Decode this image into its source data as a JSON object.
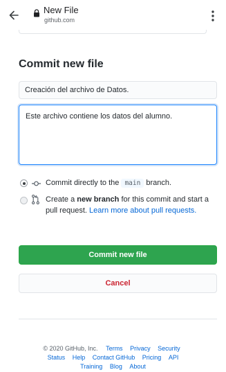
{
  "browser": {
    "page_title": "New File",
    "url": "github.com"
  },
  "form": {
    "heading": "Commit new file",
    "summary_value": "Creación del archivo de Datos.",
    "description_value": "Este archivo contiene los datos del alumno.",
    "option_direct": {
      "prefix": "Commit directly to the",
      "branch": "main",
      "suffix": "branch."
    },
    "option_new_branch": {
      "prefix": "Create a",
      "bold": "new branch",
      "middle": "for this commit and start a pull request.",
      "link": "Learn more about pull requests."
    },
    "commit_label": "Commit new file",
    "cancel_label": "Cancel"
  },
  "footer": {
    "copyright": "© 2020 GitHub, Inc.",
    "row1_links": [
      "Terms",
      "Privacy",
      "Security"
    ],
    "row2_links": [
      "Status",
      "Help",
      "Contact GitHub",
      "Pricing",
      "API"
    ],
    "row3_links": [
      "Training",
      "Blog",
      "About"
    ]
  },
  "colors": {
    "primary_green": "#2ea44f",
    "danger_red": "#cb2431",
    "link_blue": "#0366d6",
    "focus_blue": "#2188ff"
  }
}
